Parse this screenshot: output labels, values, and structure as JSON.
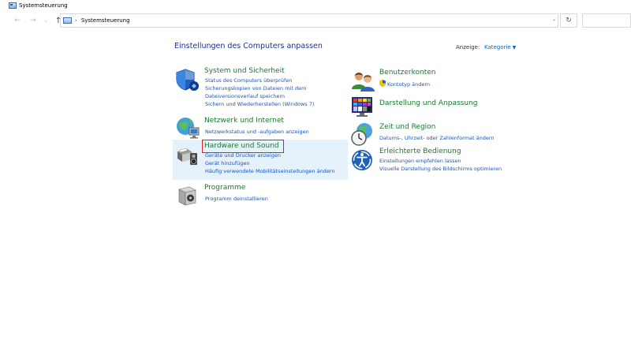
{
  "window": {
    "title": "Systemsteuerung"
  },
  "address": {
    "crumb": "Systemsteuerung"
  },
  "header": {
    "heading": "Einstellungen des Computers anpassen",
    "view_label": "Anzeige:",
    "view_value": "Kategorie"
  },
  "categories": {
    "system": {
      "title": "System und Sicherheit",
      "links": [
        "Status des Computers überprüfen",
        "Sicherungskopien von Dateien mit dem",
        "Dateiversionsverlauf speichern",
        "Sichern und Wiederherstellen (Windows 7)"
      ]
    },
    "network": {
      "title": "Netzwerk und Internet",
      "links": [
        "Netzwerkstatus und -aufgaben anzeigen"
      ]
    },
    "hardware": {
      "title": "Hardware und Sound",
      "links": [
        "Geräte und Drucker anzeigen",
        "Gerät hinzufügen",
        "Häufig verwendete Mobilitätseinstellungen ändern"
      ]
    },
    "programs": {
      "title": "Programme",
      "links": [
        "Programm deinstallieren"
      ]
    },
    "users": {
      "title": "Benutzerkonten",
      "links": [
        "Kontotyp ändern"
      ]
    },
    "appearance": {
      "title": "Darstellung und Anpassung",
      "links": []
    },
    "clock": {
      "title": "Zeit und Region",
      "links": [
        "Datums-, Uhrzeit- oder Zahlenformat ändern"
      ]
    },
    "ease": {
      "title": "Erleichterte Bedienung",
      "links": [
        "Einstellungen empfehlen lassen",
        "Visuelle Darstellung des Bildschirms optimieren"
      ]
    }
  },
  "colors": {
    "category_title": "#1a7a2e",
    "link": "#1c55b3",
    "heading": "#1e3287",
    "highlight": "#e5f1fb",
    "annotation": "#e02020"
  },
  "icons": {
    "system": "shield-icon",
    "network": "globe-network-icon",
    "hardware": "printer-speaker-icon",
    "programs": "program-box-icon",
    "users": "users-icon",
    "appearance": "palette-monitor-icon",
    "clock": "clock-globe-icon",
    "ease": "accessibility-icon"
  }
}
